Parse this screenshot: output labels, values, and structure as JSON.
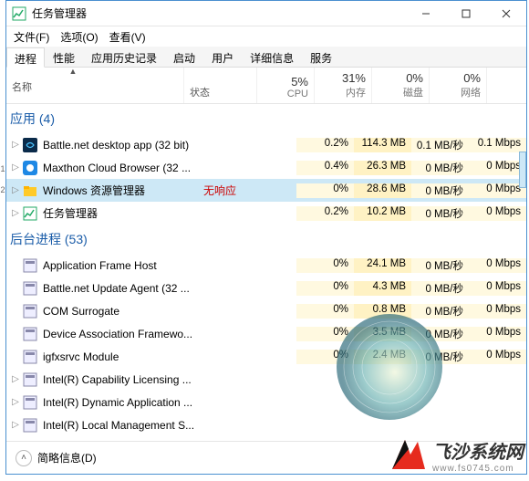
{
  "window": {
    "title": "任务管理器"
  },
  "menu": {
    "file": "文件(F)",
    "options": "选项(O)",
    "view": "查看(V)"
  },
  "tabs": [
    "进程",
    "性能",
    "应用历史记录",
    "启动",
    "用户",
    "详细信息",
    "服务"
  ],
  "active_tab": 0,
  "columns": {
    "name": "名称",
    "status": "状态",
    "cpu": {
      "pct": "5%",
      "label": "CPU"
    },
    "mem": {
      "pct": "31%",
      "label": "内存"
    },
    "disk": {
      "pct": "0%",
      "label": "磁盘"
    },
    "net": {
      "pct": "0%",
      "label": "网络"
    }
  },
  "groups": {
    "apps": {
      "title": "应用 (4)"
    },
    "bg": {
      "title": "后台进程 (53)"
    }
  },
  "rows": {
    "apps": [
      {
        "name": "Battle.net desktop app (32 bit)",
        "status": "",
        "cpu": "0.2%",
        "mem": "114.3 MB",
        "disk": "0.1 MB/秒",
        "net": "0.1 Mbps",
        "icon": "bnet"
      },
      {
        "name": "Maxthon Cloud Browser (32 ...",
        "status": "",
        "cpu": "0.4%",
        "mem": "26.3 MB",
        "disk": "0 MB/秒",
        "net": "0 Mbps",
        "icon": "maxthon"
      },
      {
        "name": "Windows 资源管理器",
        "status": "无响应",
        "cpu": "0%",
        "mem": "28.6 MB",
        "disk": "0 MB/秒",
        "net": "0 Mbps",
        "icon": "explorer",
        "selected": true
      },
      {
        "name": "任务管理器",
        "status": "",
        "cpu": "0.2%",
        "mem": "10.2 MB",
        "disk": "0 MB/秒",
        "net": "0 Mbps",
        "icon": "taskmgr"
      }
    ],
    "bg": [
      {
        "name": "Application Frame Host",
        "cpu": "0%",
        "mem": "24.1 MB",
        "disk": "0 MB/秒",
        "net": "0 Mbps",
        "icon": "generic"
      },
      {
        "name": "Battle.net Update Agent (32 ...",
        "cpu": "0%",
        "mem": "4.3 MB",
        "disk": "0 MB/秒",
        "net": "0 Mbps",
        "icon": "generic"
      },
      {
        "name": "COM Surrogate",
        "cpu": "0%",
        "mem": "0.8 MB",
        "disk": "0 MB/秒",
        "net": "0 Mbps",
        "icon": "generic"
      },
      {
        "name": "Device Association Framewo...",
        "cpu": "0%",
        "mem": "3.5 MB",
        "disk": "0 MB/秒",
        "net": "0 Mbps",
        "icon": "generic"
      },
      {
        "name": "igfxsrvc Module",
        "cpu": "0%",
        "mem": "2.4 MB",
        "disk": "0 MB/秒",
        "net": "0 Mbps",
        "icon": "generic"
      },
      {
        "name": "Intel(R) Capability Licensing ...",
        "cpu": "",
        "mem": "",
        "disk": "",
        "net": "",
        "icon": "generic"
      },
      {
        "name": "Intel(R) Dynamic Application ...",
        "cpu": "",
        "mem": "",
        "disk": "",
        "net": "",
        "icon": "generic"
      },
      {
        "name": "Intel(R) Local Management S...",
        "cpu": "",
        "mem": "",
        "disk": "",
        "net": "",
        "icon": "generic"
      }
    ]
  },
  "footer": {
    "brief": "简略信息(D)"
  },
  "watermark": {
    "brand": "飞沙系统网",
    "url": "www.fs0745.com"
  }
}
